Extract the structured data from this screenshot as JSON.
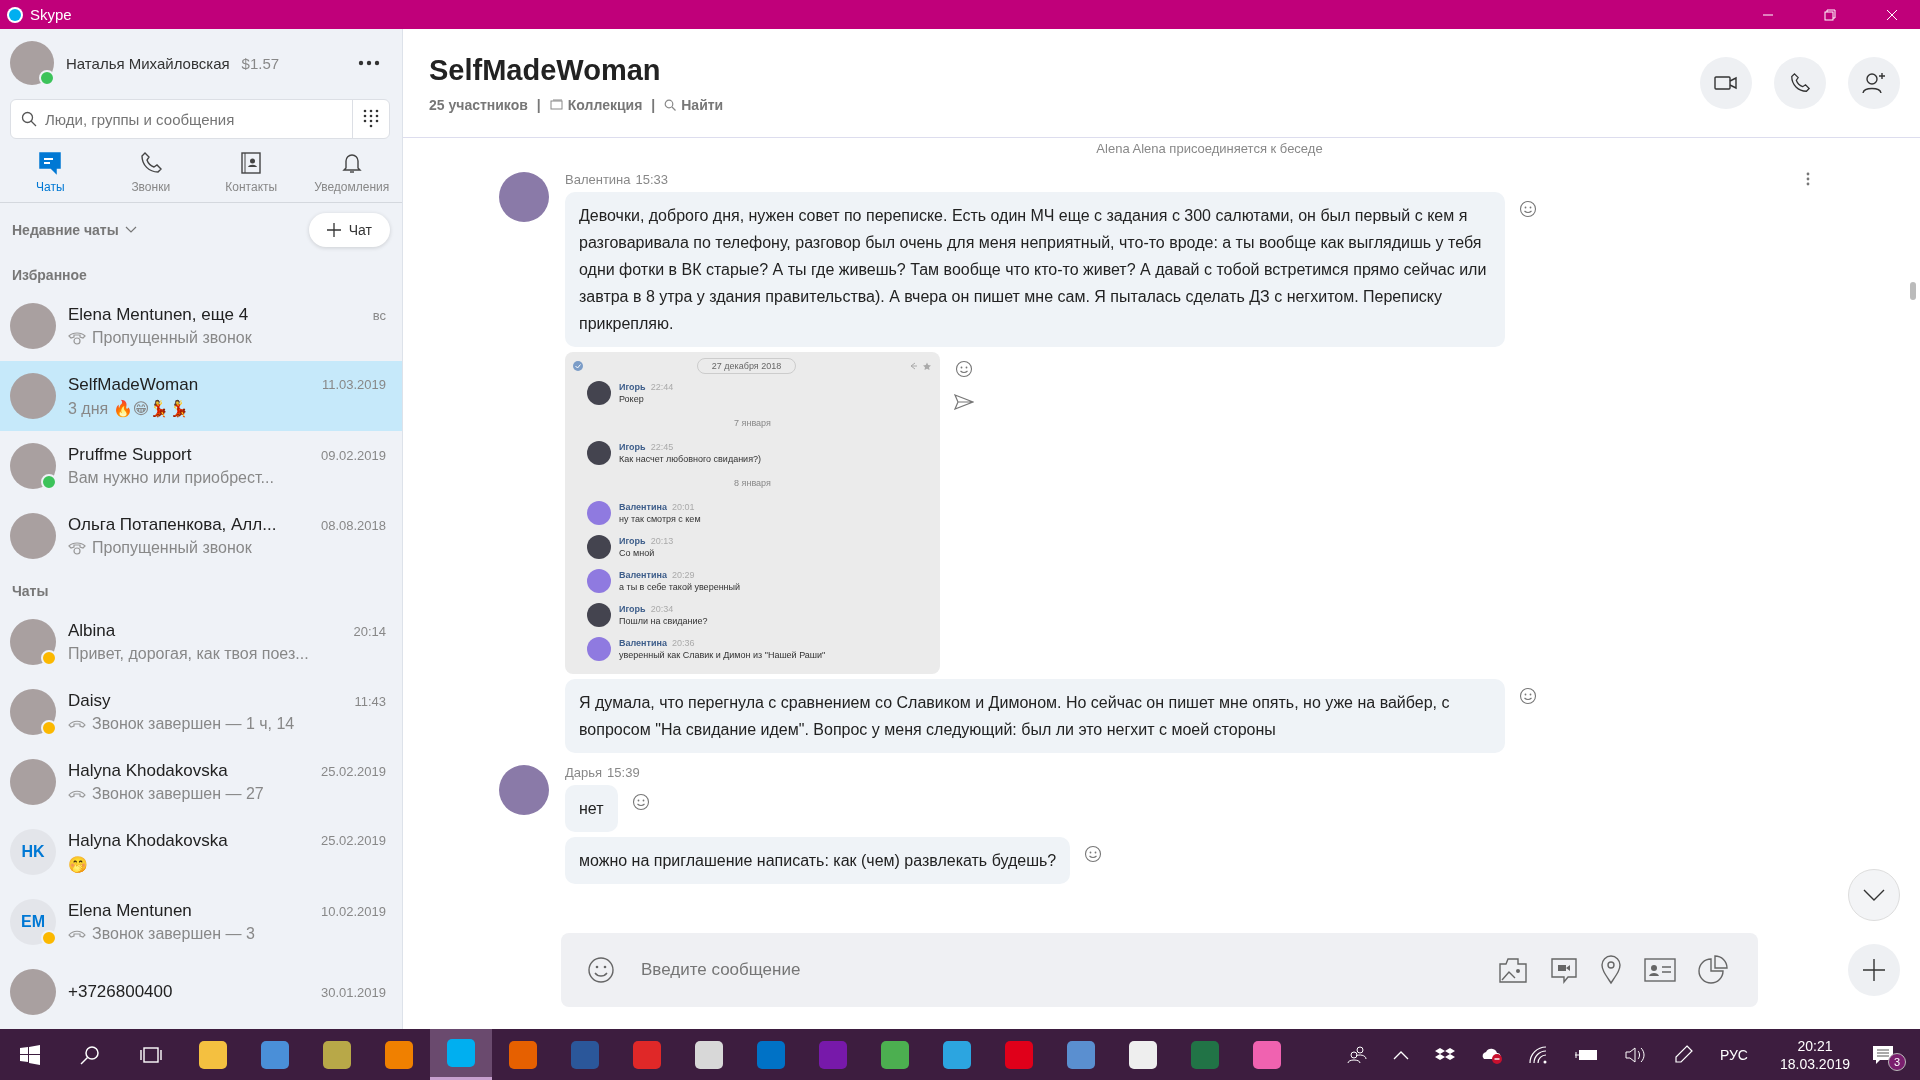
{
  "window": {
    "title": "Skype"
  },
  "profile": {
    "name": "Наталья Михайловская",
    "balance": "$1.57",
    "color": "#3cc35a"
  },
  "search": {
    "placeholder": "Люди, группы и сообщения"
  },
  "nav_tabs": [
    {
      "label": "Чаты",
      "selected": true
    },
    {
      "label": "Звонки",
      "selected": false
    },
    {
      "label": "Контакты",
      "selected": false
    },
    {
      "label": "Уведомления",
      "selected": false
    }
  ],
  "recent": {
    "label": "Недавние чаты",
    "new_chat": "Чат"
  },
  "sections": [
    {
      "title": "Избранное",
      "items": [
        {
          "name": "Elena Mentunen, еще 4",
          "time": "вс",
          "preview": "Пропущенный звонок",
          "kind": "missed_call",
          "selected": false
        },
        {
          "name": "SelfMadeWoman",
          "time": "11.03.2019",
          "preview": "3 дня 🔥😁💃💃",
          "kind": "text",
          "selected": true
        },
        {
          "name": "Pruffme Support",
          "time": "09.02.2019",
          "preview": "Вам нужно или приобрест...",
          "kind": "text",
          "color": "#3cc35a",
          "selected": false
        },
        {
          "name": "Ольга Потапенкова, Алл...",
          "time": "08.08.2018",
          "preview": "Пропущенный звонок",
          "kind": "missed_call",
          "selected": false
        }
      ]
    },
    {
      "title": "Чаты",
      "items": [
        {
          "name": "Albina",
          "time": "20:14",
          "preview": "Привет, дорогая, как твоя поез...",
          "kind": "text",
          "color": "#fbb800",
          "selected": false
        },
        {
          "name": "Daisy",
          "time": "11:43",
          "preview": "Звонок завершен — 1 ч, 14",
          "kind": "call_ended",
          "color": "#fbb800",
          "selected": false
        },
        {
          "name": "Halyna Khodakovska",
          "time": "25.02.2019",
          "preview": "Звонок завершен — 27",
          "kind": "call_ended",
          "selected": false
        },
        {
          "name": "Halyna Khodakovska",
          "time": "25.02.2019",
          "preview": "🤭",
          "kind": "text",
          "initials": "HK",
          "selected": false
        },
        {
          "name": "Elena Mentunen",
          "time": "10.02.2019",
          "preview": "Звонок завершен — 3",
          "kind": "call_ended",
          "initials": "EM",
          "color": "#fbb800",
          "selected": false
        },
        {
          "name": "+3726800400",
          "time": "30.01.2019",
          "selected": false
        }
      ]
    }
  ],
  "chat": {
    "title": "SelfMadeWoman",
    "meta": [
      {
        "kind": "link",
        "text": "25 участников"
      },
      {
        "kind": "separator",
        "text": "|"
      },
      {
        "kind": "gallery",
        "text": "Коллекция"
      },
      {
        "kind": "separator",
        "text": "|"
      },
      {
        "kind": "search",
        "text": "Найти"
      }
    ]
  },
  "system_note": "Alena Alena присоединяется к беседе",
  "messages": [
    {
      "author": "Валентина",
      "time": "15:33",
      "items": [
        {
          "kind": "text",
          "text": "Девочки, доброго дня, нужен совет по переписке. Есть один МЧ еще с задания с 300 салютами, он был первый с кем я разговаривала по телефону, разговор был очень для меня неприятный, что-то вроде: а ты вообще как выглядишь у тебя одни фотки в ВК старые? А ты где живешь? Там вообще что кто-то живет? А давай с тобой встретимся прямо сейчас или завтра в 8  утра у здания правительства). А вчера он пишет мне сам. Я пыталась сделать ДЗ с негхитом. Переписку прикрепляю."
        },
        {
          "kind": "image",
          "date_pill": "27 декабря 2018",
          "entries": [
            {
              "kind": "message",
              "color": "#44444f",
              "author": "Игорь",
              "time": "22:44",
              "text": "Рокер"
            },
            {
              "kind": "date",
              "text": "7 января"
            },
            {
              "kind": "message",
              "color": "#44444f",
              "author": "Игорь",
              "time": "22:45",
              "text": "Как насчет любовного свидания?)"
            },
            {
              "kind": "date",
              "text": "8 января"
            },
            {
              "kind": "message",
              "color": "#8f7ae0",
              "author": "Валентина",
              "time": "20:01",
              "text": "ну так смотря с кем"
            },
            {
              "kind": "message",
              "color": "#44444f",
              "author": "Игорь",
              "time": "20:13",
              "text": "Со мной"
            },
            {
              "kind": "message",
              "color": "#8f7ae0",
              "author": "Валентина",
              "time": "20:29",
              "text": "а ты в себе такой уверенный"
            },
            {
              "kind": "message",
              "color": "#44444f",
              "author": "Игорь",
              "time": "20:34",
              "text": "Пошли на свидание?"
            },
            {
              "kind": "message",
              "color": "#8f7ae0",
              "author": "Валентина",
              "time": "20:36",
              "text": "уверенный как Славик и Димон из \"Нашей Раши\""
            }
          ]
        },
        {
          "kind": "text",
          "text": "Я думала, что перегнула с сравнением со Славиком и Димоном. Но сейчас он пишет мне опять, но уже на вайбер, с вопросом \"На свидание идем\". Вопрос у меня следующий: был ли это негхит с моей стороны"
        }
      ]
    },
    {
      "author": "Дарья",
      "time": "15:39",
      "items": [
        {
          "kind": "text",
          "text": "нет"
        },
        {
          "kind": "text",
          "text": "можно на приглашение написать: как (чем) развлекать будешь?"
        }
      ]
    }
  ],
  "compose": {
    "placeholder": "Введите сообщение"
  },
  "taskbar": {
    "apps": [
      {
        "color": "#f4c040",
        "active": false
      },
      {
        "color": "#4a8fd8",
        "active": false
      },
      {
        "color": "#b8a848",
        "active": false
      },
      {
        "color": "#f08000",
        "active": false
      },
      {
        "color": "#00aff0",
        "active": true
      },
      {
        "color": "#e66000",
        "active": false
      },
      {
        "color": "#2b579a",
        "active": false
      },
      {
        "color": "#e02828",
        "active": false
      },
      {
        "color": "#d8d8d8",
        "active": false
      },
      {
        "color": "#0072c6",
        "active": false
      },
      {
        "color": "#7719aa",
        "active": false
      },
      {
        "color": "#4caf50",
        "active": false
      },
      {
        "color": "#2ca5e0",
        "active": false
      },
      {
        "color": "#e0001a",
        "active": false
      },
      {
        "color": "#5a8fd0",
        "active": false
      },
      {
        "color": "#eeeeee",
        "active": false
      },
      {
        "color": "#217346",
        "active": false
      },
      {
        "color": "#f062b0",
        "active": false
      }
    ],
    "language": "РУС",
    "time": "20:21",
    "date": "18.03.2019",
    "notifications": "3"
  }
}
